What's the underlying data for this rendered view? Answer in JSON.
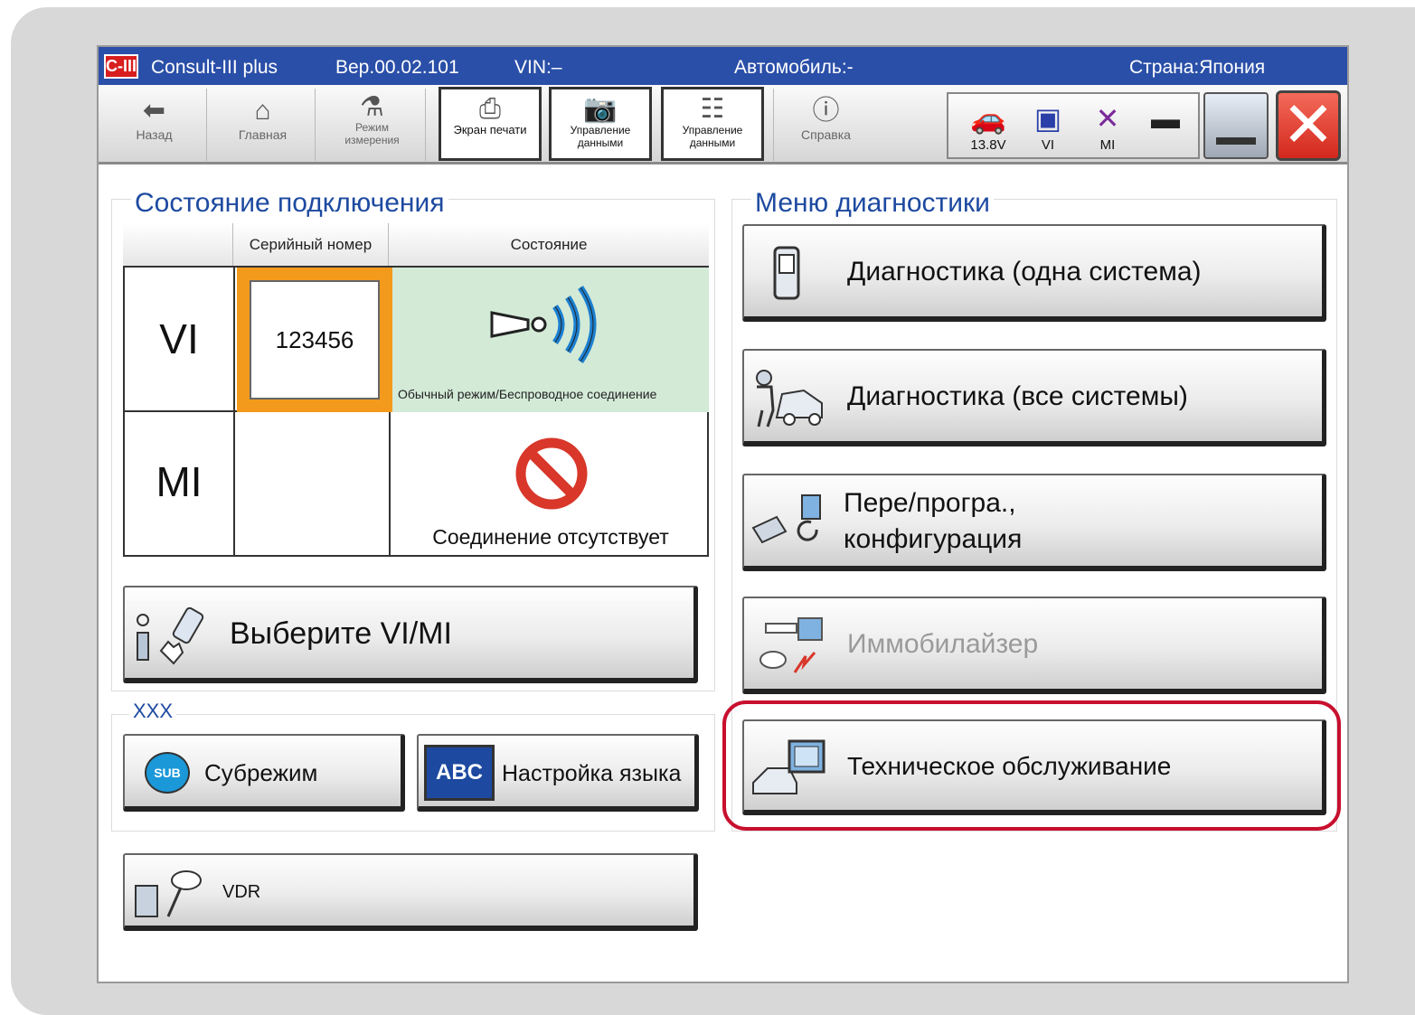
{
  "titlebar": {
    "logo": "C-III",
    "app_name": "Consult-III plus",
    "version": "Вер.00.02.101",
    "vin": "VIN:–",
    "vehicle": "Автомобиль:-",
    "country": "Страна:Япония"
  },
  "toolbar": {
    "back": "Назад",
    "home": "Главная",
    "mode_line1": "Режим",
    "mode_line2": "измерения",
    "print_screen": "Экран печати",
    "data_mgmt_line1": "Управление",
    "data_mgmt_line2": "данными",
    "data_mgmt2_line1": "Управление",
    "data_mgmt2_line2": "данными",
    "help": "Справка",
    "voltage": "13.8V",
    "vi": "VI",
    "mi": "MI"
  },
  "connection": {
    "title": "Состояние подключения",
    "col_serial": "Серийный номер",
    "col_status": "Состояние",
    "rows": [
      {
        "label": "VI",
        "serial": "123456",
        "status": "Обычный режим/Беспроводное соединение"
      },
      {
        "label": "MI",
        "serial": "",
        "status": "Соединение отсутствует"
      }
    ]
  },
  "select_vimi": "Выберите VI/MI",
  "sub_section": {
    "title": "XXX",
    "submode": "Субрежим",
    "sub_badge": "SUB",
    "language": "Настройка языка",
    "abc_badge": "ABC"
  },
  "vdr": "VDR",
  "diag_menu": {
    "title": "Меню диагностики",
    "items": [
      {
        "label": "Диагностика (одна система)",
        "enabled": true
      },
      {
        "label": "Диагностика (все системы)",
        "enabled": true
      },
      {
        "label_line1": "Пере/програ.,",
        "label_line2": "конфигурация",
        "enabled": true
      },
      {
        "label": "Иммобилайзер",
        "enabled": false
      },
      {
        "label": "Техническое обслуживание",
        "enabled": true,
        "highlighted": true
      }
    ]
  },
  "colors": {
    "titlebar": "#2a4fa8",
    "section_title": "#1d4aa0",
    "serial_highlight": "#f39a1c",
    "wireless_bg": "#d3ead7",
    "highlight_ring": "#c8102e"
  }
}
